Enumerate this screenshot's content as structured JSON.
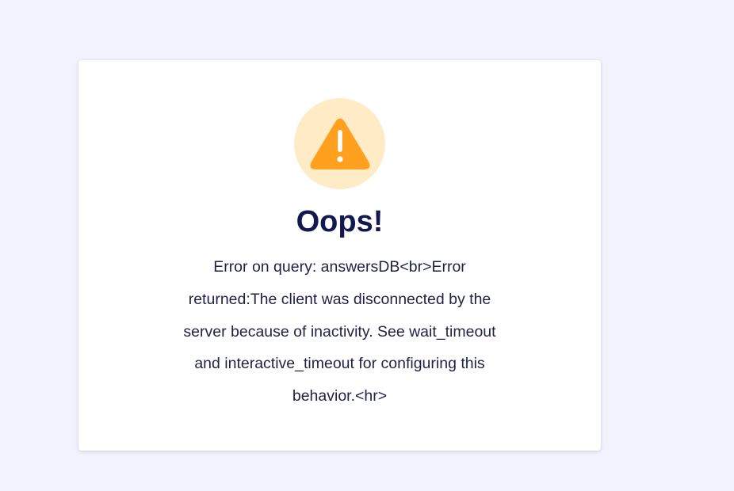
{
  "error_card": {
    "icon": "warning-triangle-icon",
    "title": "Oops!",
    "message": "Error on query: answersDB<br>Error returned:The client was disconnected by the server because of inactivity. See wait_timeout and interactive_timeout for configuring this behavior.<hr>"
  },
  "colors": {
    "background": "#f2f2fe",
    "card": "#ffffff",
    "icon_circle": "#ffebc6",
    "icon_triangle": "#ffa11f",
    "title": "#13194f"
  }
}
